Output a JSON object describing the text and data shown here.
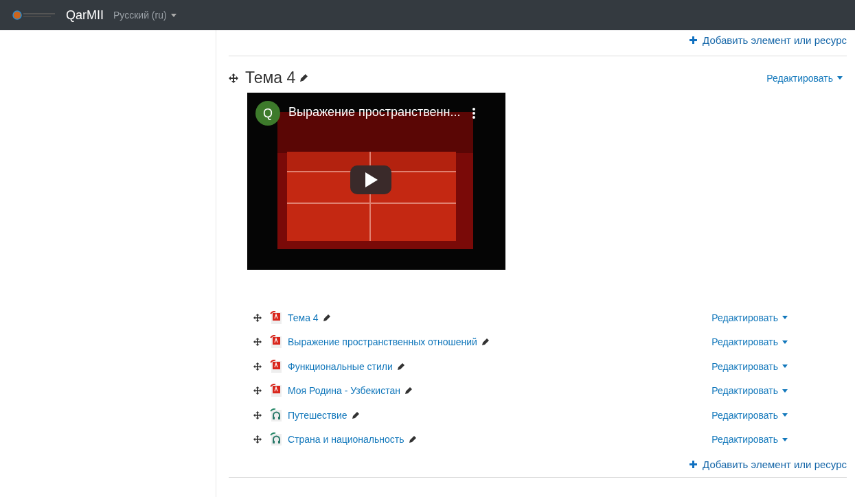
{
  "navbar": {
    "brand": "QarMII",
    "language": "Русский (ru)"
  },
  "top_add_link": "Добавить элемент или ресурс",
  "section": {
    "title": "Тема 4",
    "edit_menu": "Редактировать",
    "video": {
      "kind": "picture",
      "channel_letter": "Q",
      "title": "Выражение пространственн..."
    },
    "activities": [
      {
        "kind": "pdf",
        "name": "Тема 4",
        "edit_menu": "Редактировать"
      },
      {
        "kind": "pdf",
        "name": "Выражение пространственных отношений",
        "edit_menu": "Редактировать"
      },
      {
        "kind": "pdf",
        "name": "Функциональные стили",
        "edit_menu": "Редактировать"
      },
      {
        "kind": "pdf",
        "name": "Моя Родина - Узбекистан",
        "edit_menu": "Редактировать"
      },
      {
        "kind": "audio",
        "name": "Путешествие",
        "edit_menu": "Редактировать"
      },
      {
        "kind": "audio",
        "name": "Страна и национальность",
        "edit_menu": "Редактировать"
      }
    ],
    "add_link": "Добавить элемент или ресурс"
  }
}
